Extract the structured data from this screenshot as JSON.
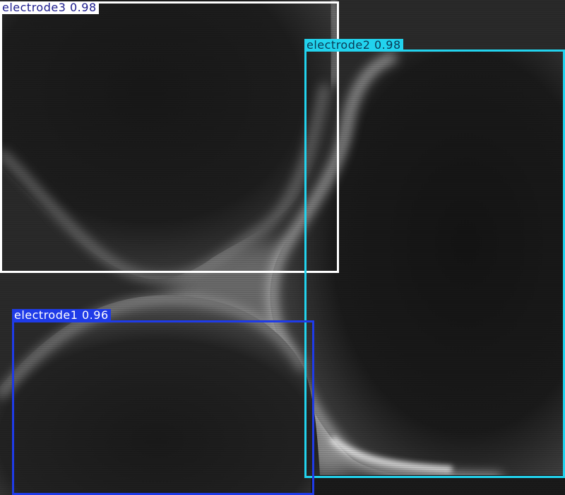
{
  "detections": [
    {
      "label": "electrode3",
      "score": "0.98",
      "color": "#ffffff",
      "text_color": "#1a1a8c"
    },
    {
      "label": "electrode2",
      "score": "0.98",
      "color": "#22d3ee",
      "text_color": "#0a3a55"
    },
    {
      "label": "electrode1",
      "score": "0.96",
      "color": "#1f3be8",
      "text_color": "#ffffff"
    }
  ]
}
